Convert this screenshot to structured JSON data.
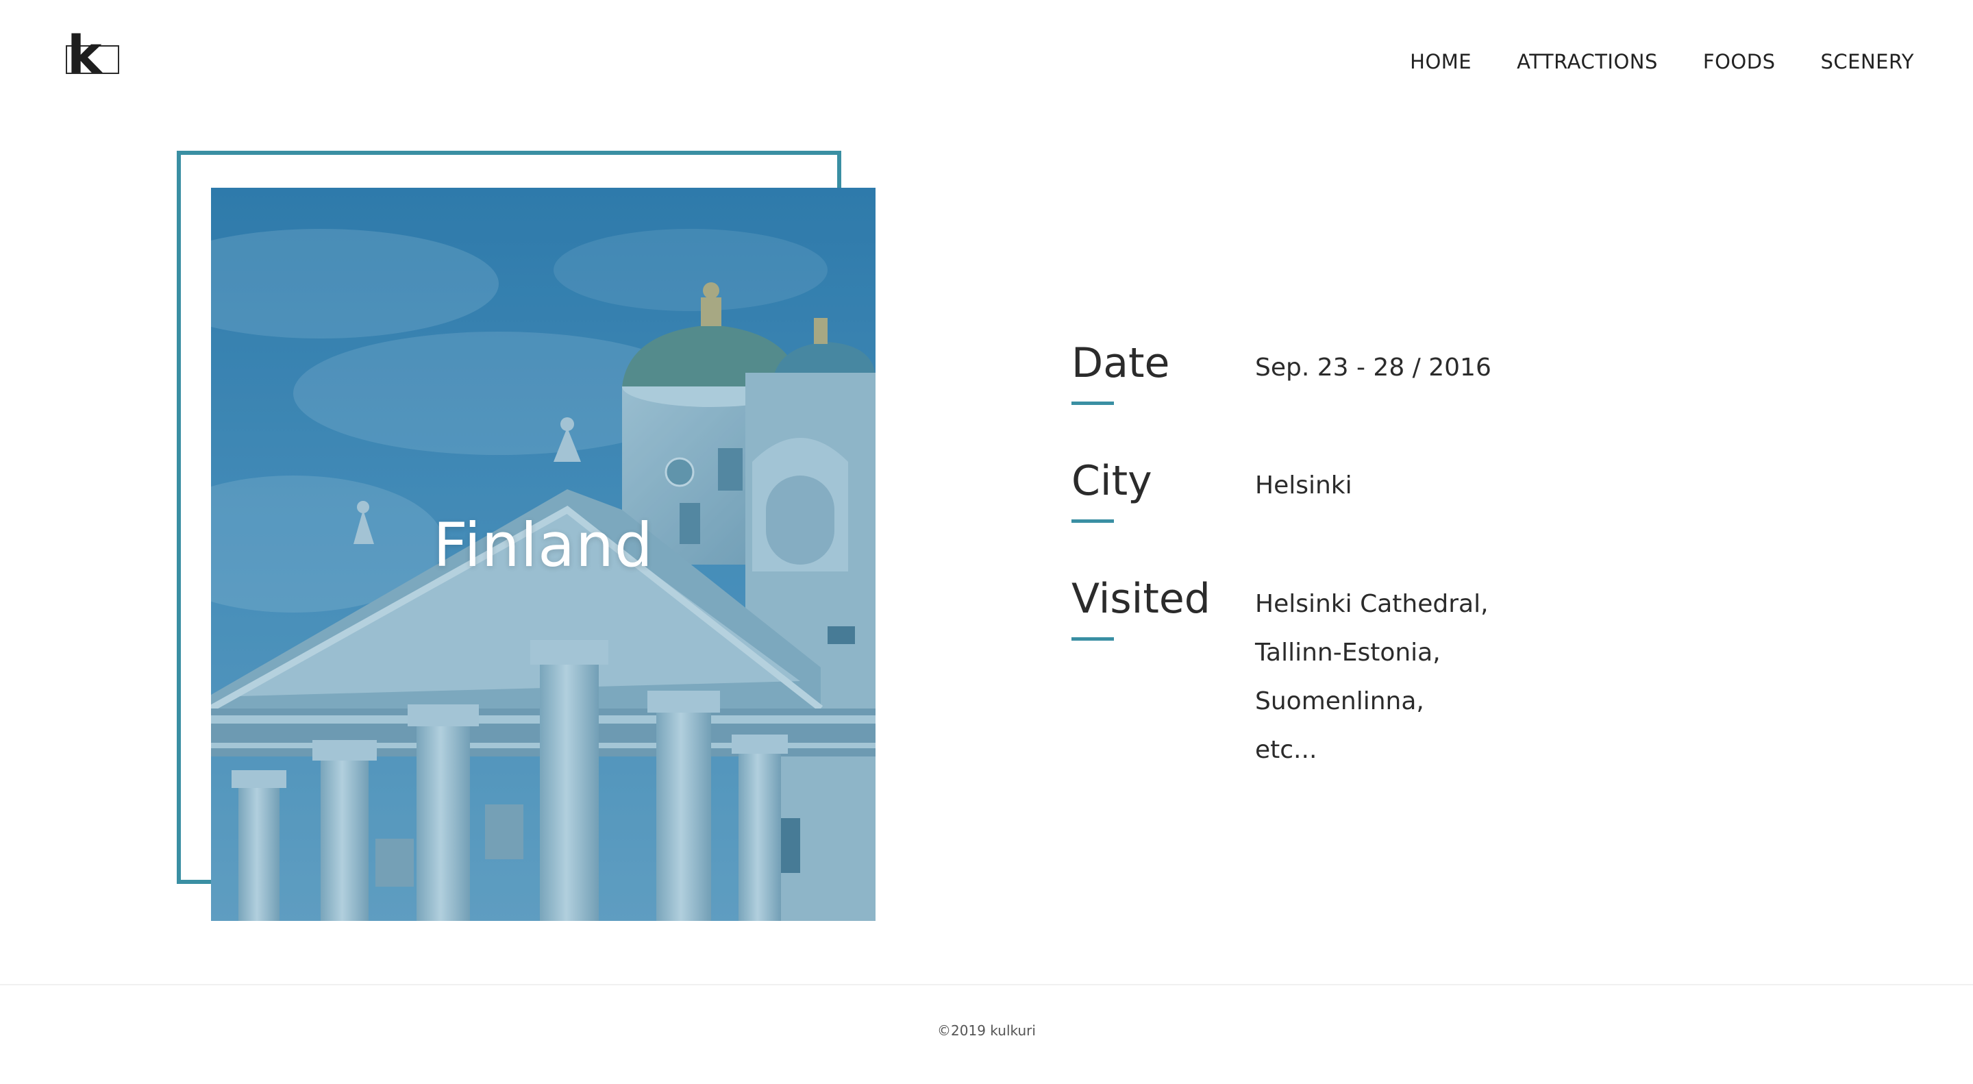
{
  "logo": {
    "letter": "k"
  },
  "nav": {
    "items": [
      {
        "label": "HOME"
      },
      {
        "label": "ATTRACTIONS"
      },
      {
        "label": "FOODS"
      },
      {
        "label": "SCENERY"
      }
    ]
  },
  "hero": {
    "title": "Finland",
    "accent_color": "#3a8fa3"
  },
  "info": {
    "date": {
      "label": "Date",
      "value": "Sep. 23 - 28 / 2016"
    },
    "city": {
      "label": "City",
      "value": "Helsinki"
    },
    "visited": {
      "label": "Visited",
      "items": [
        "Helsinki Cathedral,",
        "Tallinn-Estonia,",
        "Suomenlinna,",
        "etc..."
      ]
    }
  },
  "footer": {
    "copyright": "©2019 kulkuri"
  }
}
